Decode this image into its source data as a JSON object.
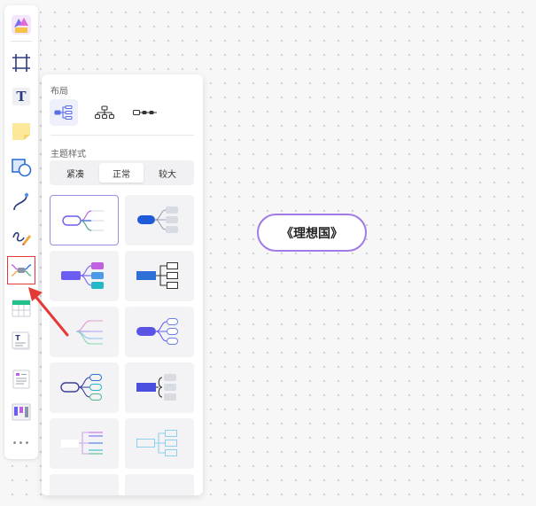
{
  "toolbar": {
    "tools": [
      "logo-icon",
      "frame-icon",
      "text-icon",
      "sticky-note-icon",
      "shape-icon",
      "connector-icon",
      "pen-icon",
      "mindmap-icon",
      "table-icon",
      "text-card-icon",
      "list-card-icon",
      "kanban-icon",
      "more-icon"
    ],
    "text_tool_glyph": "T",
    "more_glyph": "•••"
  },
  "panel": {
    "layout_title": "布局",
    "theme_title": "主题样式",
    "density": [
      "紧凑",
      "正常",
      "较大"
    ],
    "active_density": "正常",
    "colors": {
      "purple": "#6b5cf2",
      "blue": "#2f6fd8",
      "cyan": "#22b8c8",
      "magenta": "#c061e0",
      "green": "#52b788"
    }
  },
  "canvas": {
    "topic": "《理想国》",
    "topic_border": "#a27be6"
  },
  "annotation": {
    "color": "#e53935"
  }
}
